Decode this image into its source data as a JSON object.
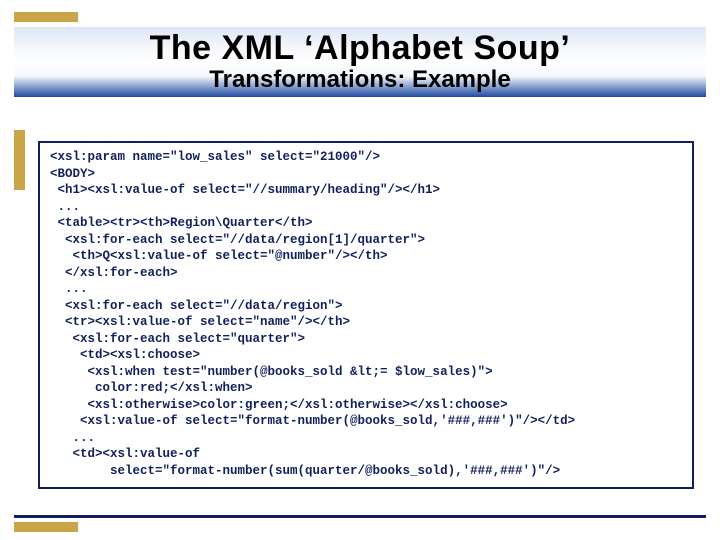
{
  "title": "The XML ‘Alphabet Soup’",
  "subtitle": "Transformations: Example",
  "code": "<xsl:param name=\"low_sales\" select=\"21000\"/>\n<BODY>\n <h1><xsl:value-of select=\"//summary/heading\"/></h1>\n ...\n <table><tr><th>Region\\Quarter</th>\n  <xsl:for-each select=\"//data/region[1]/quarter\">\n   <th>Q<xsl:value-of select=\"@number\"/></th>\n  </xsl:for-each>\n  ...\n  <xsl:for-each select=\"//data/region\">\n  <tr><xsl:value-of select=\"name\"/></th>\n   <xsl:for-each select=\"quarter\">\n    <td><xsl:choose>\n     <xsl:when test=\"number(@books_sold &lt;= $low_sales)\">\n      color:red;</xsl:when>\n     <xsl:otherwise>color:green;</xsl:otherwise></xsl:choose>\n    <xsl:value-of select=\"format-number(@books_sold,'###,###')\"/></td>\n   ...\n   <td><xsl:value-of\n        select=\"format-number(sum(quarter/@books_sold),'###,###')\"/>"
}
